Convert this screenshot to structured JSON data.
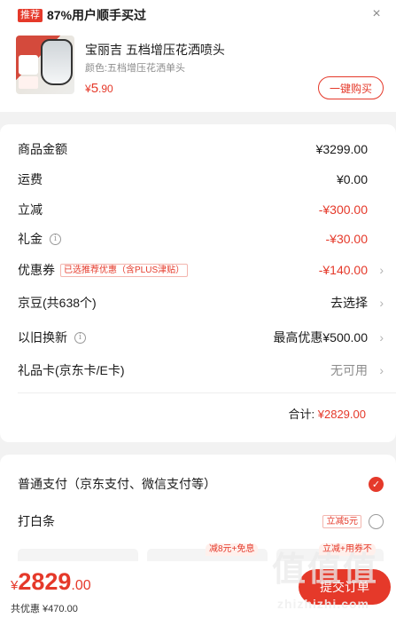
{
  "recommend": {
    "tag": "推荐",
    "title": "87%用户顺手买过",
    "close_icon": "×",
    "product": {
      "name": "宝丽吉 五档增压花洒喷头",
      "color": "颜色:五档增压花洒单头",
      "price_symbol": "¥",
      "price_int": "5",
      "price_dec": ".90",
      "buy_label": "一键购买"
    }
  },
  "summary": {
    "rows": [
      {
        "label": "商品金额",
        "value": "¥3299.00"
      },
      {
        "label": "运费",
        "value": "¥0.00"
      },
      {
        "label": "立减",
        "value": "-¥300.00"
      },
      {
        "label": "礼金",
        "value": "-¥30.00"
      },
      {
        "label": "优惠券",
        "tag": "已选推荐优惠（含PLUS津贴）",
        "value": "-¥140.00"
      },
      {
        "label": "京豆(共638个)",
        "value": "去选择"
      },
      {
        "label": "以旧换新",
        "value": "最高优惠¥500.00"
      },
      {
        "label": "礼品卡(京东卡/E卡)",
        "value": "无可用"
      }
    ],
    "total_label": "合计:",
    "total_value": "¥2829.00"
  },
  "payment": {
    "normal_label": "普通支付（京东支付、微信支付等）",
    "baitiao_label": "打白条",
    "baitiao_tag": "立减5元",
    "plan_tags": [
      "减8元+免息",
      "立减+用券不"
    ],
    "check_icon": "✓"
  },
  "bottom": {
    "price_symbol": "¥",
    "price_int": "2829",
    "price_dec": ".00",
    "saved_label": "共优惠 ¥470.00",
    "submit_label": "提交订单"
  },
  "watermark": {
    "logo": "值值值",
    "url": "zhizhizhi.com"
  },
  "colors": {
    "accent": "#e5392a",
    "bg": "#f2f2f2"
  }
}
